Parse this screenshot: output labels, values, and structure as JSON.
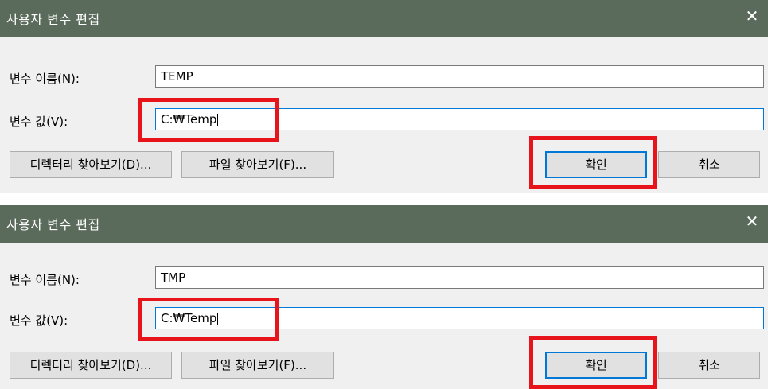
{
  "panels": [
    {
      "title": "사용자 변수 편집",
      "close_glyph": "✕",
      "name_label": "변수 이름(N):",
      "name_value": "TEMP",
      "value_label": "변수 값(V):",
      "value_value": "C:₩Temp",
      "browse_dir_label": "디렉터리 찾아보기(D)...",
      "browse_file_label": "파일 찾아보기(F)...",
      "ok_label": "확인",
      "cancel_label": "취소"
    },
    {
      "title": "사용자 변수 편집",
      "close_glyph": "✕",
      "name_label": "변수 이름(N):",
      "name_value": "TMP",
      "value_label": "변수 값(V):",
      "value_value": "C:₩Temp",
      "browse_dir_label": "디렉터리 찾아보기(D)...",
      "browse_file_label": "파일 찾아보기(F)...",
      "ok_label": "확인",
      "cancel_label": "취소"
    }
  ],
  "colors": {
    "titlebar": "#5b6b5b",
    "highlight": "#e8141b",
    "focus": "#0078d7"
  }
}
